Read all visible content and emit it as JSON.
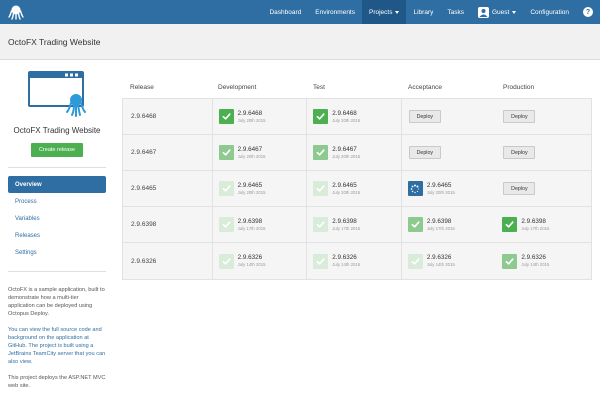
{
  "nav": {
    "items": [
      {
        "label": "Dashboard",
        "active": false,
        "caret": false
      },
      {
        "label": "Environments",
        "active": false,
        "caret": false
      },
      {
        "label": "Projects",
        "active": true,
        "caret": true
      },
      {
        "label": "Library",
        "active": false,
        "caret": false
      },
      {
        "label": "Tasks",
        "active": false,
        "caret": false
      }
    ],
    "user_label": "Guest",
    "config_label": "Configuration",
    "help_label": "?"
  },
  "header": {
    "title": "OctoFX Trading Website"
  },
  "sidebar": {
    "project_name": "OctoFX Trading Website",
    "create_release_label": "Create release",
    "items": [
      {
        "label": "Overview",
        "active": true
      },
      {
        "label": "Process",
        "active": false
      },
      {
        "label": "Variables",
        "active": false
      },
      {
        "label": "Releases",
        "active": false
      },
      {
        "label": "Settings",
        "active": false
      }
    ],
    "desc1": "OctoFX is a sample application, built to demonstrate how a multi-tier application can be deployed using Octopus Deploy.",
    "desc2": "You can view the full source code and background on the application at GitHub. The project is built using a JetBrains TeamCity server that you can also view.",
    "desc3": "This project deploys the ASP.NET MVC web site."
  },
  "dashboard": {
    "headers": [
      "Release",
      "Development",
      "Test",
      "Acceptance",
      "Production"
    ],
    "deploy_label": "Deploy",
    "rows": [
      {
        "release": "2.9.6468",
        "cells": [
          {
            "type": "done",
            "shade": 1,
            "version": "2.9.6468",
            "date": "July 20th 2015"
          },
          {
            "type": "done",
            "shade": 1,
            "version": "2.9.6468",
            "date": "July 20th 2015"
          },
          {
            "type": "deploy"
          },
          {
            "type": "deploy"
          }
        ]
      },
      {
        "release": "2.9.6467",
        "cells": [
          {
            "type": "done",
            "shade": 2,
            "version": "2.9.6467",
            "date": "July 20th 2015"
          },
          {
            "type": "done",
            "shade": 2,
            "version": "2.9.6467",
            "date": "July 20th 2015"
          },
          {
            "type": "deploy"
          },
          {
            "type": "deploy"
          }
        ]
      },
      {
        "release": "2.9.6465",
        "cells": [
          {
            "type": "done",
            "shade": 3,
            "version": "2.9.6465",
            "date": "July 20th 2015"
          },
          {
            "type": "done",
            "shade": 3,
            "version": "2.9.6465",
            "date": "July 20th 2015"
          },
          {
            "type": "running",
            "version": "2.9.6465",
            "date": "July 20th 2015"
          },
          {
            "type": "deploy"
          }
        ]
      },
      {
        "release": "2.9.6398",
        "cells": [
          {
            "type": "done",
            "shade": 3,
            "version": "2.9.6398",
            "date": "July 17th 2015"
          },
          {
            "type": "done",
            "shade": 3,
            "version": "2.9.6398",
            "date": "July 17th 2015"
          },
          {
            "type": "done",
            "shade": 2,
            "version": "2.9.6398",
            "date": "July 17th 2015"
          },
          {
            "type": "done",
            "shade": 1,
            "version": "2.9.6398",
            "date": "July 17th 2015"
          }
        ]
      },
      {
        "release": "2.9.6326",
        "cells": [
          {
            "type": "done",
            "shade": 3,
            "version": "2.9.6326",
            "date": "July 14th 2015"
          },
          {
            "type": "done",
            "shade": 3,
            "version": "2.9.6326",
            "date": "July 14th 2015"
          },
          {
            "type": "done",
            "shade": 3,
            "version": "2.9.6326",
            "date": "July 14th 2015"
          },
          {
            "type": "done",
            "shade": 2,
            "version": "2.9.6326",
            "date": "July 14th 2015"
          }
        ]
      }
    ]
  },
  "colors": {
    "nav_bg": "#2f6ea3",
    "nav_active": "#1f5888",
    "success": "#4caf50",
    "success_mid": "#8ec98f",
    "success_light": "#d9ecd9",
    "running": "#2f6ea3"
  }
}
